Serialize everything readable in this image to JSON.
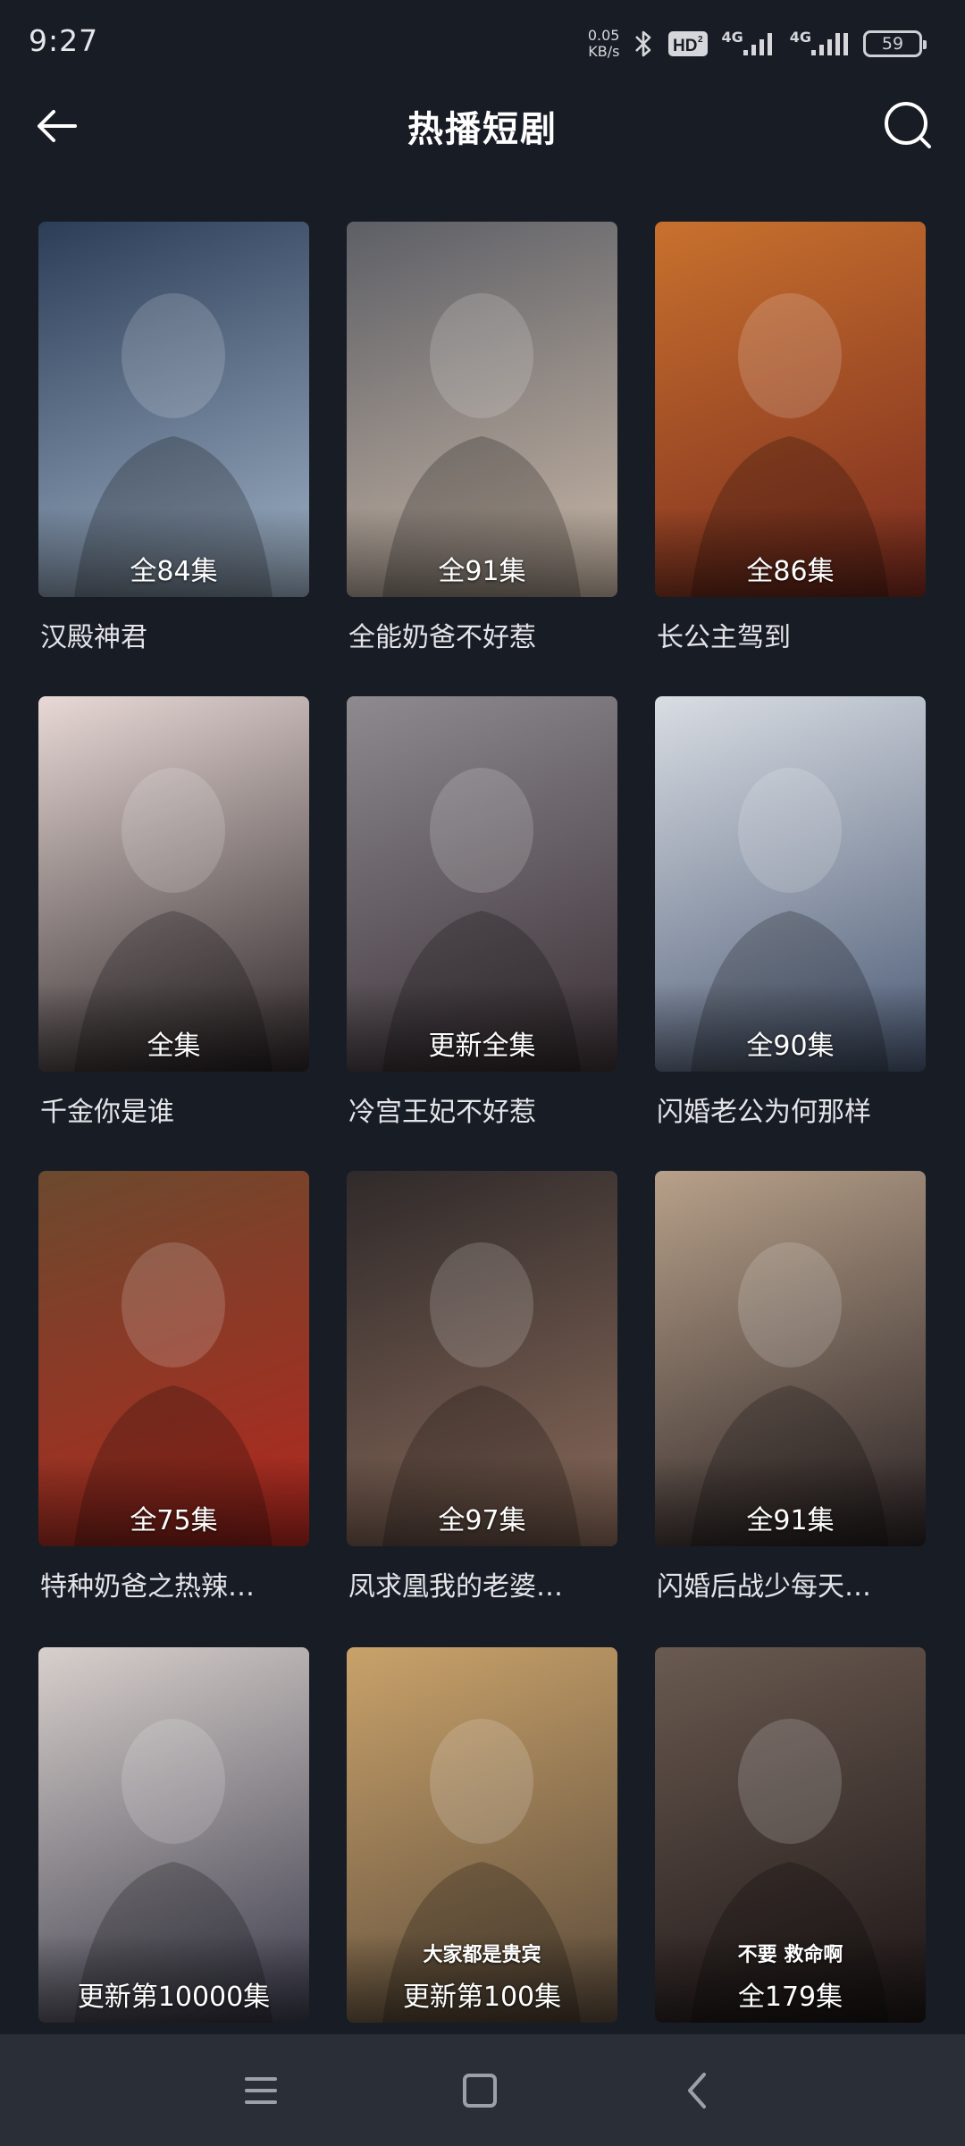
{
  "status": {
    "time": "9:27",
    "net_speed_value": "0.05",
    "net_speed_unit": "KB/s",
    "hd_label": "HD",
    "sim1_label": "4G",
    "sim2_label": "4G",
    "battery": "59"
  },
  "header": {
    "title": "热播短剧",
    "back_icon": "back-arrow-icon",
    "search_icon": "search-icon"
  },
  "dramas": [
    {
      "title": "汉殿神君",
      "episodes": "全84集",
      "poster_text": "",
      "colors": [
        "#2c3d58",
        "#9fb2c6"
      ]
    },
    {
      "title": "全能奶爸不好惹",
      "episodes": "全91集",
      "poster_text": "",
      "colors": [
        "#5d5f66",
        "#c9b7a6"
      ]
    },
    {
      "title": "长公主驾到",
      "episodes": "全86集",
      "poster_text": "",
      "colors": [
        "#c8712e",
        "#7a2a1e"
      ]
    },
    {
      "title": "千金你是谁",
      "episodes": "全集",
      "poster_text": "",
      "colors": [
        "#e8d9d6",
        "#2b2426"
      ]
    },
    {
      "title": "冷宫王妃不好惹",
      "episodes": "更新全集",
      "poster_text": "",
      "colors": [
        "#8d8a90",
        "#3b3035"
      ]
    },
    {
      "title": "闪婚老公为何那样",
      "episodes": "全90集",
      "poster_text": "",
      "colors": [
        "#d9dde3",
        "#4b5a75"
      ]
    },
    {
      "title": "特种奶爸之热辣…",
      "episodes": "全75集",
      "poster_text": "",
      "colors": [
        "#6b4a2e",
        "#b3261e"
      ]
    },
    {
      "title": "凤求凰我的老婆…",
      "episodes": "全97集",
      "poster_text": "",
      "colors": [
        "#2f2a2a",
        "#8a6a5a"
      ]
    },
    {
      "title": "闪婚后战少每天…",
      "episodes": "全91集",
      "poster_text": "",
      "colors": [
        "#b8a18a",
        "#2a2224"
      ]
    },
    {
      "title": "",
      "episodes": "更新第10000集",
      "poster_text": "",
      "colors": [
        "#d8d0cc",
        "#3a3a4a"
      ]
    },
    {
      "title": "",
      "episodes": "更新第100集",
      "poster_text": "大家都是贵宾",
      "colors": [
        "#c9a26a",
        "#5a4a3a"
      ]
    },
    {
      "title": "",
      "episodes": "全179集",
      "poster_text": "不要 救命啊",
      "colors": [
        "#6a5a50",
        "#1c1516"
      ]
    }
  ],
  "nav": {
    "menu_icon": "menu-icon",
    "home_icon": "home-square-icon",
    "back_icon": "back-chevron-icon"
  }
}
